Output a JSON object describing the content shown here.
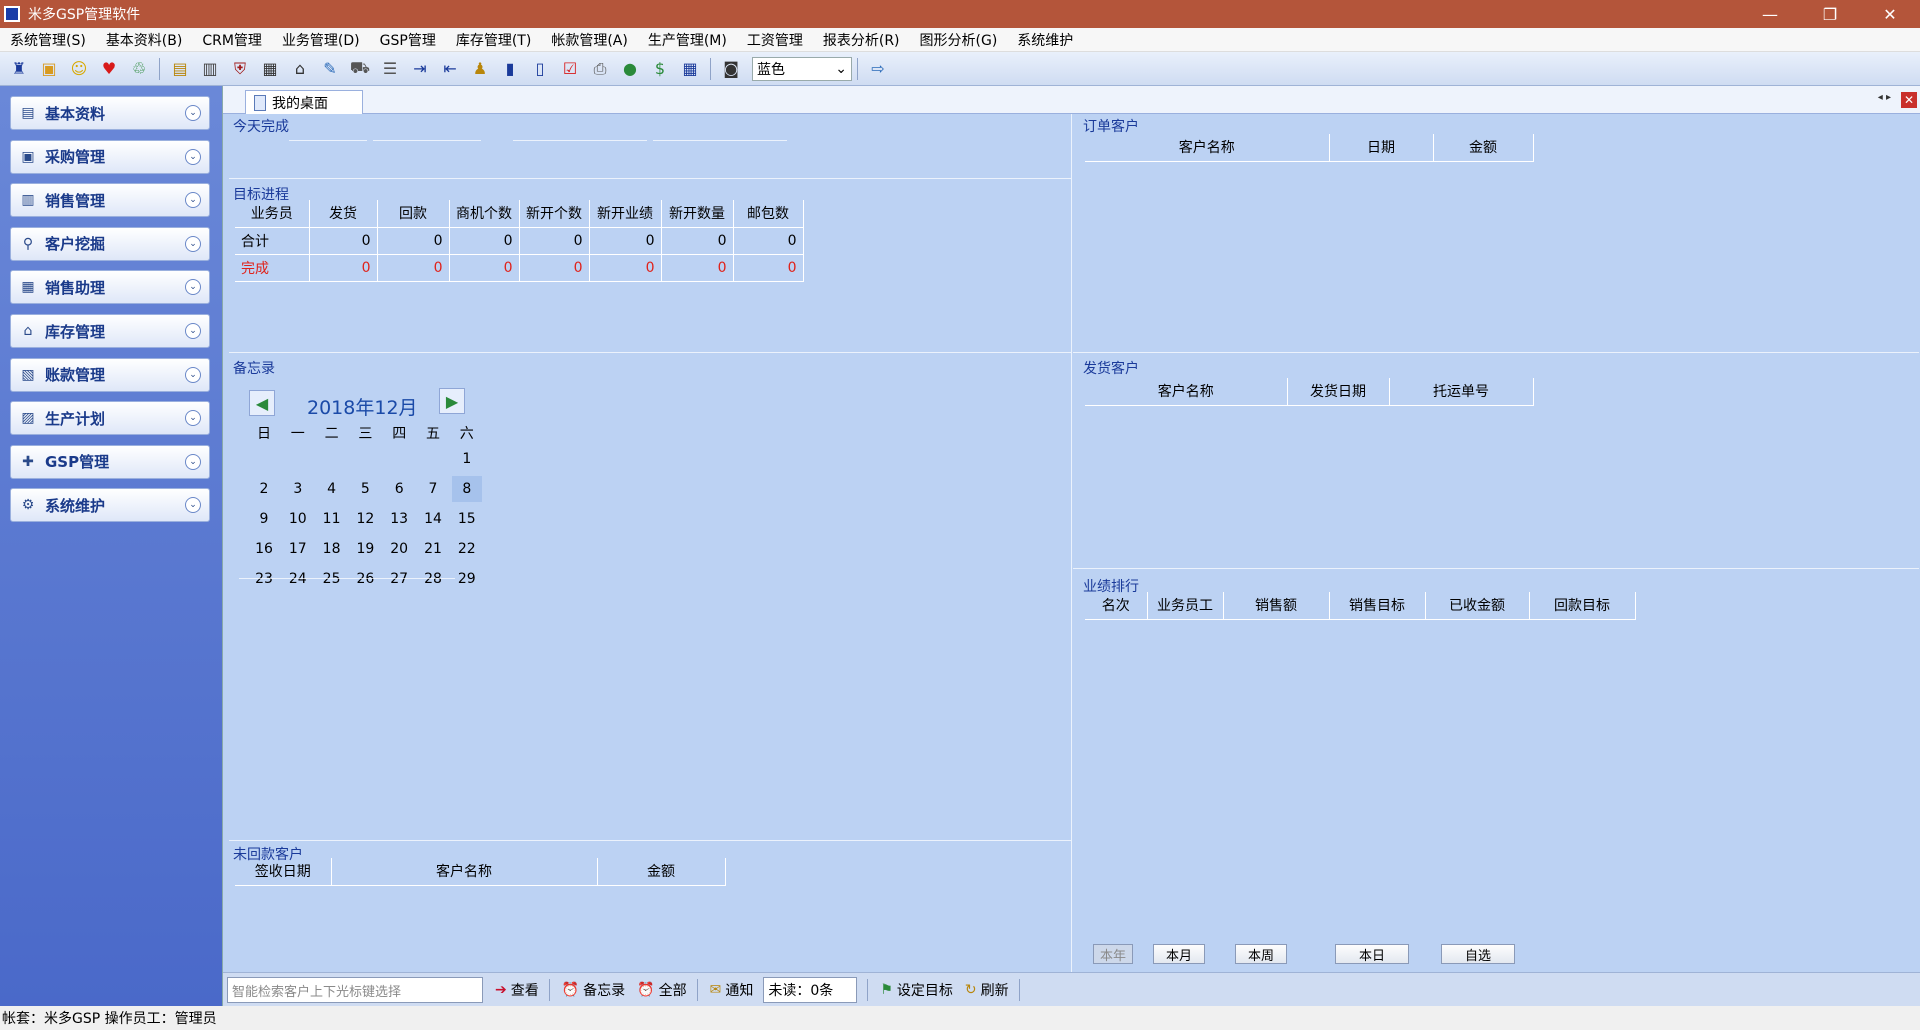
{
  "window": {
    "title": "米多GSP管理软件",
    "controls": {
      "minimize": "—",
      "restore": "❐",
      "close": "✕"
    }
  },
  "menu": [
    "系统管理(S)",
    "基本资料(B)",
    "CRM管理",
    "业务管理(D)",
    "GSP管理",
    "库存管理(T)",
    "帐款管理(A)",
    "生产管理(M)",
    "工资管理",
    "报表分析(R)",
    "图形分析(G)",
    "系统维护"
  ],
  "toolbar": {
    "icons": [
      {
        "name": "shield-icon",
        "glyph": "♜",
        "color": "#1a3a9a"
      },
      {
        "name": "box-icon",
        "glyph": "▣",
        "color": "#d89a20"
      },
      {
        "name": "smiley-icon",
        "glyph": "☺",
        "color": "#d8a800"
      },
      {
        "name": "heart-icon",
        "glyph": "♥",
        "color": "#d81a1a"
      },
      {
        "name": "recycle-icon",
        "glyph": "♲",
        "color": "#2a8a3a"
      },
      {
        "name": "document-icon",
        "glyph": "▤",
        "color": "#b8860b"
      },
      {
        "name": "report-icon",
        "glyph": "▥",
        "color": "#444"
      },
      {
        "name": "shield-red-icon",
        "glyph": "⛨",
        "color": "#a01a1a"
      },
      {
        "name": "calculator-icon",
        "glyph": "▦",
        "color": "#333"
      },
      {
        "name": "tag-icon",
        "glyph": "⌂",
        "color": "#333"
      },
      {
        "name": "pen-icon",
        "glyph": "✎",
        "color": "#2a6ab8"
      },
      {
        "name": "truck-icon",
        "glyph": "⛟",
        "color": "#555"
      },
      {
        "name": "list-icon",
        "glyph": "☰",
        "color": "#555"
      },
      {
        "name": "import-icon",
        "glyph": "⇥",
        "color": "#1a3a9a"
      },
      {
        "name": "export-icon",
        "glyph": "⇤",
        "color": "#1a3a9a"
      },
      {
        "name": "users-icon",
        "glyph": "♟",
        "color": "#b8860b"
      },
      {
        "name": "barcode-icon",
        "glyph": "▮",
        "color": "#1a3a9a"
      },
      {
        "name": "scanner-icon",
        "glyph": "▯",
        "color": "#1a3a9a"
      },
      {
        "name": "checklist-icon",
        "glyph": "☑",
        "color": "#d81a1a"
      },
      {
        "name": "printer-icon",
        "glyph": "⎙",
        "color": "#555"
      },
      {
        "name": "money-bag-icon",
        "glyph": "●",
        "color": "#2a8a3a"
      },
      {
        "name": "dollar-icon",
        "glyph": "$",
        "color": "#2a8a3a"
      },
      {
        "name": "grid-icon",
        "glyph": "▦",
        "color": "#1a3a9a"
      },
      {
        "name": "chat-icon",
        "glyph": "◙",
        "color": "#333"
      }
    ],
    "theme_value": "蓝色",
    "exit_icon": {
      "name": "exit-icon",
      "glyph": "⇨",
      "color": "#2a6ab8"
    }
  },
  "sidebar": [
    {
      "label": "基本资料",
      "icon": "database-icon",
      "glyph": "▤"
    },
    {
      "label": "采购管理",
      "icon": "purchase-icon",
      "glyph": "▣"
    },
    {
      "label": "销售管理",
      "icon": "sales-icon",
      "glyph": "▥"
    },
    {
      "label": "客户挖掘",
      "icon": "customer-mining-icon",
      "glyph": "⚲"
    },
    {
      "label": "销售助理",
      "icon": "calendar-icon",
      "glyph": "▦"
    },
    {
      "label": "库存管理",
      "icon": "warehouse-icon",
      "glyph": "⌂"
    },
    {
      "label": "账款管理",
      "icon": "accounts-icon",
      "glyph": "▧"
    },
    {
      "label": "生产计划",
      "icon": "production-icon",
      "glyph": "▨"
    },
    {
      "label": "GSP管理",
      "icon": "gsp-icon",
      "glyph": "✚"
    },
    {
      "label": "系统维护",
      "icon": "maintenance-icon",
      "glyph": "⚙"
    }
  ],
  "tab": {
    "label": "我的桌面",
    "nav": "◂ ▸",
    "close": "✕"
  },
  "today_done": {
    "title": "今天完成"
  },
  "target_progress": {
    "title": "目标进程",
    "headers": [
      "业务员",
      "发货",
      "回款",
      "商机个数",
      "新开个数",
      "新开业绩",
      "新开数量",
      "邮包数"
    ],
    "rows": [
      {
        "label": "合计",
        "values": [
          "0",
          "0",
          "0",
          "0",
          "0",
          "0",
          "0"
        ],
        "red": false
      },
      {
        "label": "完成",
        "values": [
          "0",
          "0",
          "0",
          "0",
          "0",
          "0",
          "0"
        ],
        "red": true
      }
    ]
  },
  "memo": {
    "title": "备忘录",
    "month": "2018年12月",
    "weekdays": [
      "日",
      "一",
      "二",
      "三",
      "四",
      "五",
      "六"
    ],
    "weeks": [
      [
        "",
        "",
        "",
        "",
        "",
        "",
        "1"
      ],
      [
        "2",
        "3",
        "4",
        "5",
        "6",
        "7",
        "8"
      ],
      [
        "9",
        "10",
        "11",
        "12",
        "13",
        "14",
        "15"
      ],
      [
        "16",
        "17",
        "18",
        "19",
        "20",
        "21",
        "22"
      ],
      [
        "23",
        "24",
        "25",
        "26",
        "27",
        "28",
        "29"
      ]
    ],
    "today": "8"
  },
  "unpaid": {
    "title": "未回款客户",
    "headers": [
      "签收日期",
      "客户名称",
      "金额"
    ]
  },
  "orders": {
    "title": "订单客户",
    "headers": [
      "客户名称",
      "日期",
      "金额"
    ]
  },
  "shipping": {
    "title": "发货客户",
    "headers": [
      "客户名称",
      "发货日期",
      "托运单号"
    ]
  },
  "ranking": {
    "title": "业绩排行",
    "headers": [
      "名次",
      "业务员工",
      "销售额",
      "销售目标",
      "已收金额",
      "回款目标"
    ],
    "periods": [
      {
        "label": "本年",
        "enabled": false
      },
      {
        "label": "本月",
        "enabled": true
      },
      {
        "label": "本周",
        "enabled": true
      },
      {
        "label": "本日",
        "enabled": true
      },
      {
        "label": "自选",
        "enabled": true
      }
    ]
  },
  "bottom": {
    "search_placeholder": "智能检索客户上下光标键选择",
    "view": "查看",
    "memo": "备忘录",
    "all": "全部",
    "notice": "通知",
    "unread": "未读：0条",
    "set_target": "设定目标",
    "refresh": "刷新"
  },
  "status": "帐套：米多GSP 操作员工：管理员"
}
